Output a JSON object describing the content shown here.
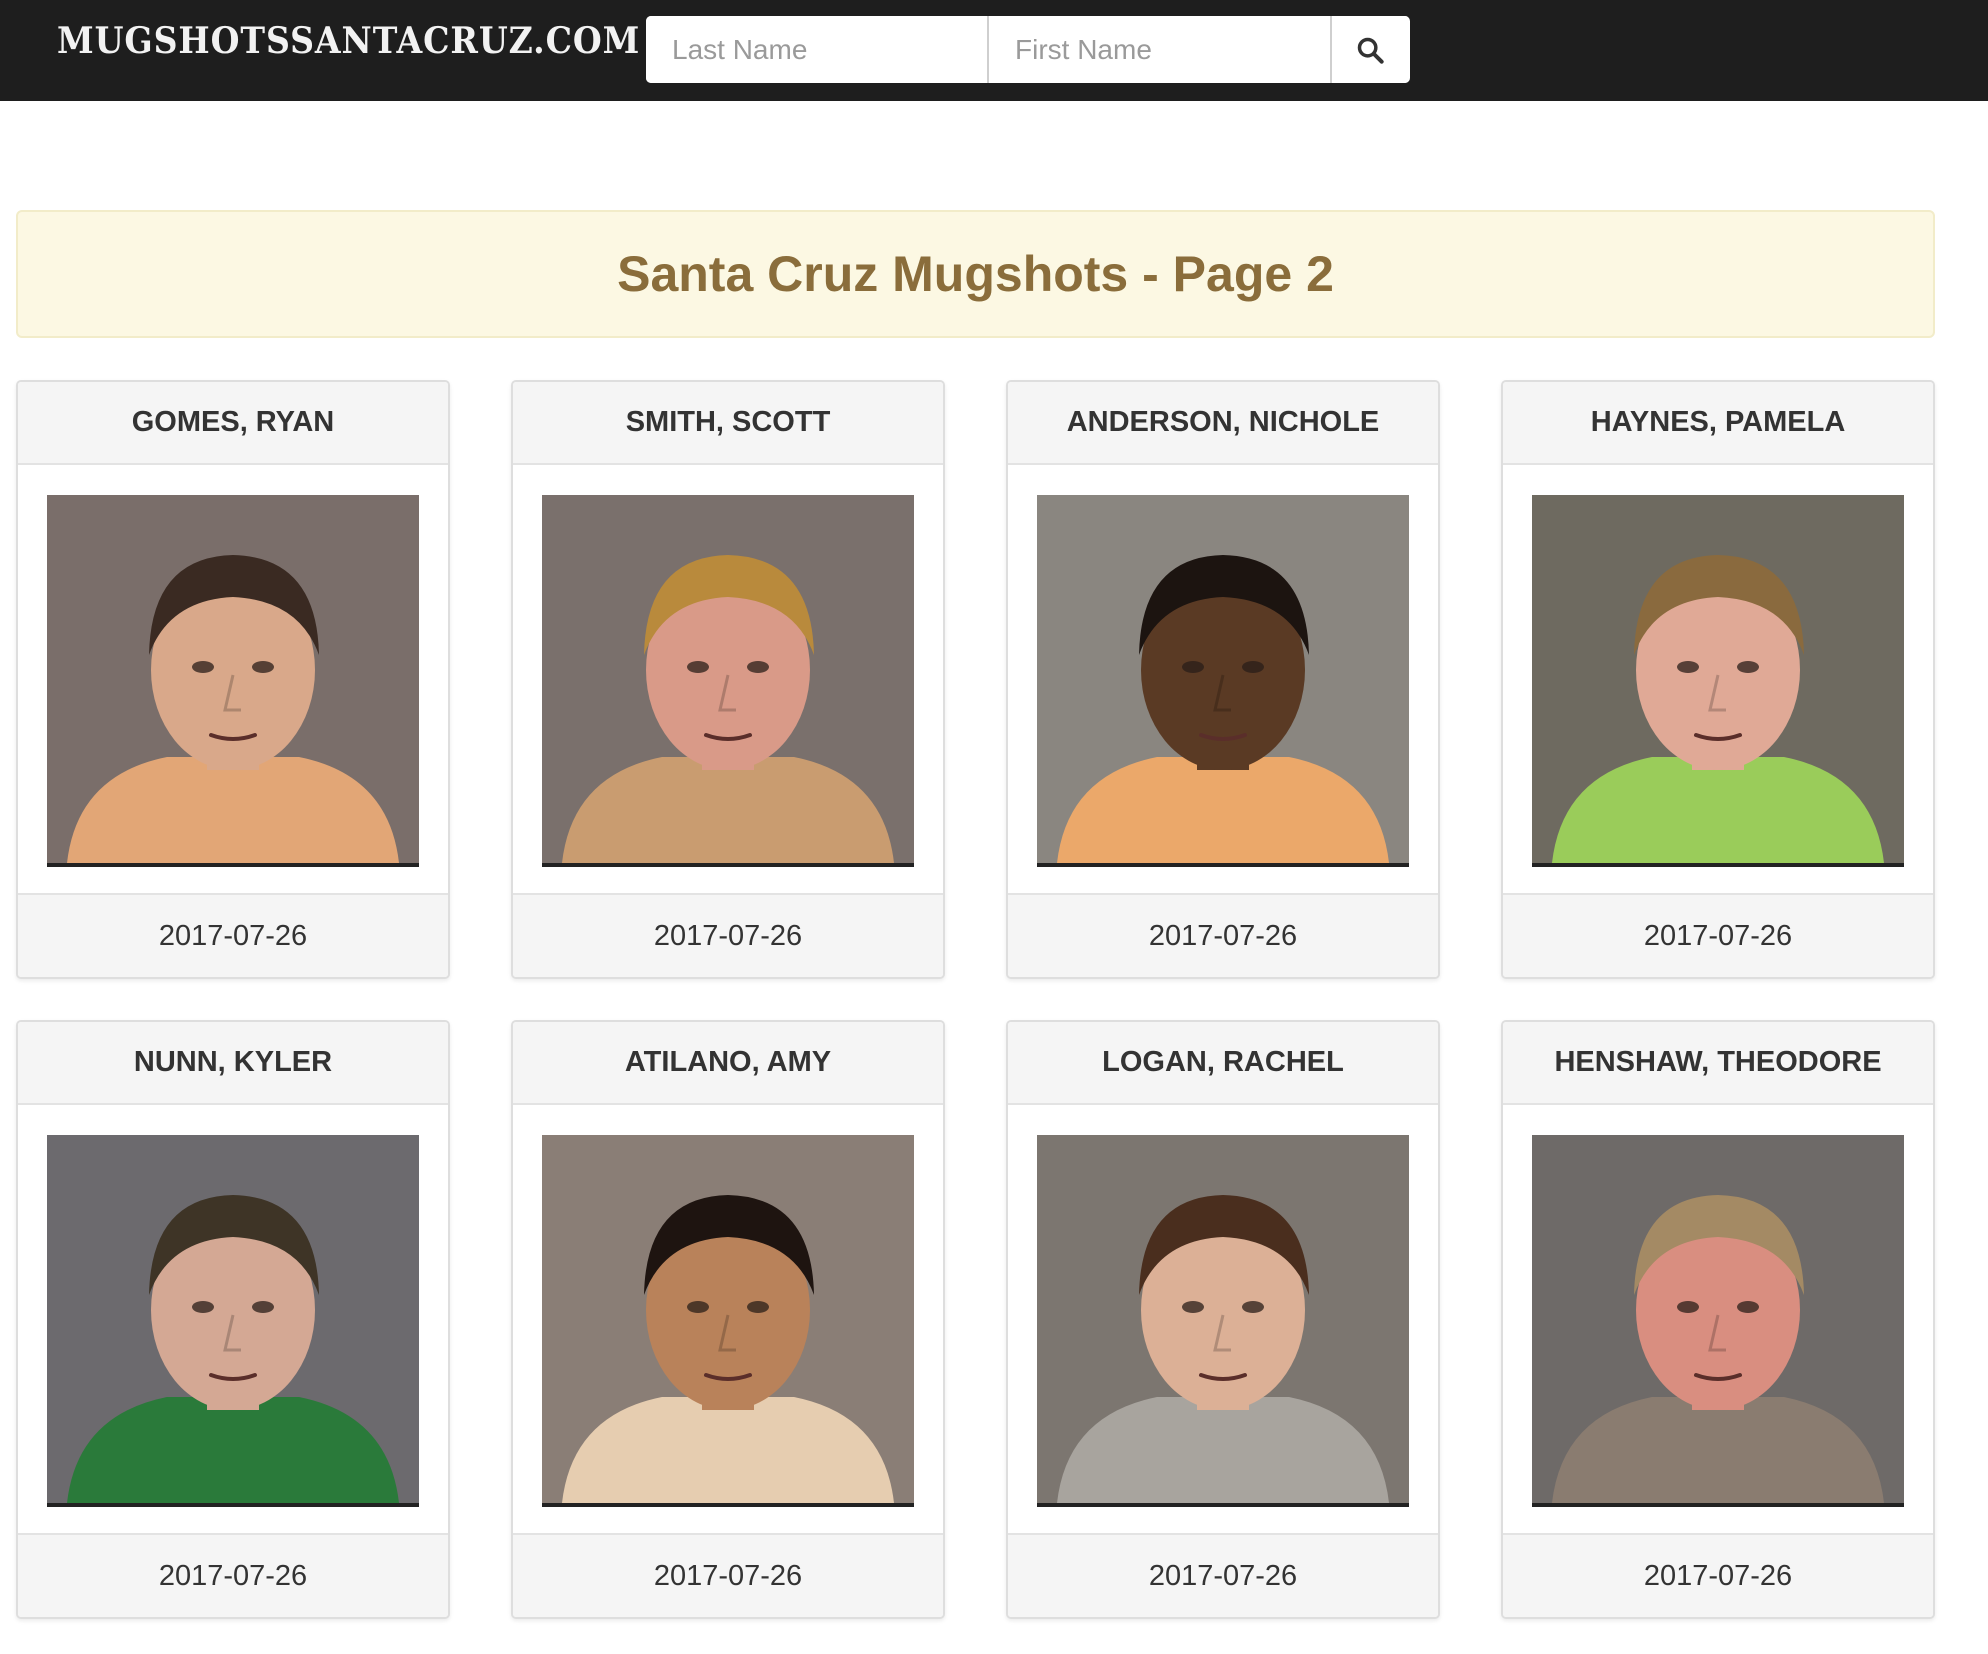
{
  "header": {
    "brand": "MUGSHOTSSANTACRUZ.COM",
    "search": {
      "last_name_placeholder": "Last Name",
      "first_name_placeholder": "First Name",
      "button_icon": "search-icon"
    }
  },
  "banner": {
    "title": "Santa Cruz Mugshots - Page 2"
  },
  "mugshots": [
    {
      "name": "GOMES, RYAN",
      "date": "2017-07-26",
      "bg": "#7a6e6a",
      "skin": "#d9a88a",
      "hair": "#3a2a22",
      "shirt": "#e2a676"
    },
    {
      "name": "SMITH, SCOTT",
      "date": "2017-07-26",
      "bg": "#7a706c",
      "skin": "#d99a88",
      "hair": "#b98a3c",
      "shirt": "#c99c70"
    },
    {
      "name": "ANDERSON, NICHOLE",
      "date": "2017-07-26",
      "bg": "#8a8680",
      "skin": "#5a3a24",
      "hair": "#1c1410",
      "shirt": "#eba86a"
    },
    {
      "name": "HAYNES, PAMELA",
      "date": "2017-07-26",
      "bg": "#6e6a60",
      "skin": "#e0a996",
      "hair": "#8a6a3e",
      "shirt": "#9acc5a"
    },
    {
      "name": "NUNN, KYLER",
      "date": "2017-07-26",
      "bg": "#6c6a6e",
      "skin": "#d4a894",
      "hair": "#3e3426",
      "shirt": "#2a7a3a"
    },
    {
      "name": "ATILANO, AMY",
      "date": "2017-07-26",
      "bg": "#8a7e76",
      "skin": "#b9825a",
      "hair": "#1e1410",
      "shirt": "#e6cdb0"
    },
    {
      "name": "LOGAN, RACHEL",
      "date": "2017-07-26",
      "bg": "#7c7670",
      "skin": "#dcb096",
      "hair": "#4a2e1e",
      "shirt": "#a8a49e"
    },
    {
      "name": "HENSHAW, THEODORE",
      "date": "2017-07-26",
      "bg": "#6e6a68",
      "skin": "#d98e80",
      "hair": "#a48a64",
      "shirt": "#8a7c70"
    }
  ]
}
